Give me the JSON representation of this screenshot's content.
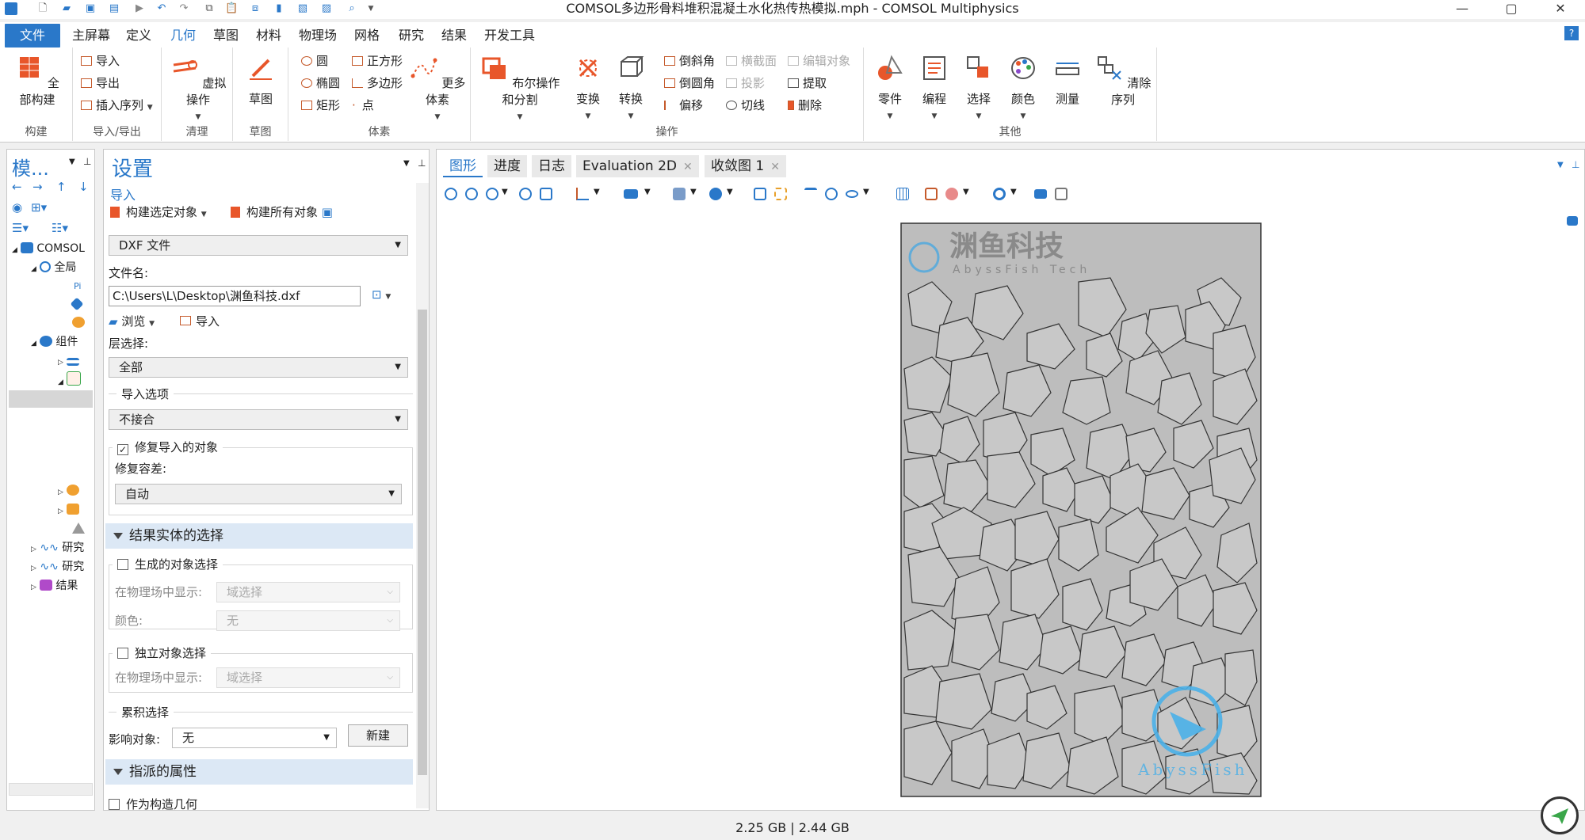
{
  "window": {
    "title": "COMSOL多边形骨料堆积混凝土水化热传热模拟.mph - COMSOL Multiphysics",
    "quick_access_icons": [
      "app-logo-icon",
      "new-file-icon",
      "open-icon",
      "save-icon",
      "save-as-icon",
      "run-icon",
      "undo-icon",
      "redo-icon",
      "copy-icon",
      "paste-icon",
      "duplicate-icon",
      "delete-icon",
      "select-icon",
      "clear-icon",
      "find-icon"
    ],
    "controls": {
      "minimize": "—",
      "maximize": "▢",
      "close": "✕"
    }
  },
  "ribbon_tabs": [
    "文件",
    "主屏幕",
    "定义",
    "几何",
    "草图",
    "材料",
    "物理场",
    "网格",
    "研究",
    "结果",
    "开发工具"
  ],
  "active_tab": "几何",
  "help_icon": "?",
  "ribbon": {
    "build": {
      "label": "构建",
      "build_all": "全部构建"
    },
    "import_export": {
      "label": "导入/导出",
      "import": "导入",
      "export": "导出",
      "insert_sequence": "插入序列"
    },
    "cleanup": {
      "label": "清理",
      "virtual_ops": "虚拟操作"
    },
    "sketch": {
      "label": "草图",
      "sketch": "草图"
    },
    "primitives": {
      "label": "体素",
      "circle": "圆",
      "ellipse": "椭圆",
      "rectangle": "矩形",
      "square": "正方形",
      "polygon": "多边形",
      "point": "点",
      "more": "更多体素"
    },
    "operations": {
      "label": "操作",
      "boolean": "布尔操作和分割",
      "transforms": "变换",
      "conversions": "转换",
      "chamfer": "倒斜角",
      "fillet": "倒圆角",
      "offset": "偏移",
      "cross_section": "横截面",
      "projection": "投影",
      "tangent": "切线",
      "edit_object": "编辑对象",
      "extract": "提取",
      "delete": "删除"
    },
    "other": {
      "label": "其他",
      "parts": "零件",
      "programming": "编程",
      "selections": "选择",
      "colors": "颜色",
      "measure": "测量",
      "clear_sequence": "清除序列"
    }
  },
  "model_builder": {
    "title": "模...",
    "tree": [
      {
        "label": "COMSOL",
        "icon": "model-icon"
      },
      {
        "label": "全局",
        "icon": "globe-icon"
      },
      {
        "label": "Pi",
        "icon": "parameters-icon"
      },
      {
        "label": "",
        "icon": "materials-icon"
      },
      {
        "label": "",
        "icon": "functions-icon"
      },
      {
        "label": "组件",
        "icon": "component-icon"
      },
      {
        "label": "",
        "icon": "definitions-icon"
      },
      {
        "label": "",
        "icon": "geometry-icon"
      },
      {
        "label": "",
        "icon": "physics-icon"
      },
      {
        "label": "",
        "icon": "material-icon"
      },
      {
        "label": "",
        "icon": "mesh-icon"
      },
      {
        "label": "研究",
        "icon": "study-icon"
      },
      {
        "label": "研究",
        "icon": "study-icon"
      },
      {
        "label": "结果",
        "icon": "results-icon"
      }
    ]
  },
  "settings": {
    "title": "设置",
    "subtitle": "导入",
    "build_selected": "构建选定对象",
    "build_all": "构建所有对象",
    "source": "DXF 文件",
    "filename_label": "文件名:",
    "filename": "C:\\Users\\L\\Desktop\\渊鱼科技.dxf",
    "browse": "浏览",
    "import": "导入",
    "layer_label": "层选择:",
    "layer_value": "全部",
    "import_options_label": "导入选项",
    "import_options_value": "不接合",
    "repair_label": "修复导入的对象",
    "repair_checked": true,
    "repair_tol_label": "修复容差:",
    "repair_tol_value": "自动",
    "section_result": "结果实体的选择",
    "gen_sel_label": "生成的对象选择",
    "show_in_physics_label": "在物理场中显示:",
    "show_in_physics_value": "域选择",
    "color_label": "颜色:",
    "color_value": "无",
    "indep_sel_label": "独立对象选择",
    "show_in_physics_label2": "在物理场中显示:",
    "show_in_physics_value2": "域选择",
    "cumulative_label": "累积选择",
    "contribute_label": "影响对象:",
    "contribute_value": "无",
    "new_button": "新建",
    "section_assigned": "指派的属性",
    "construction_geom": "作为构造几何"
  },
  "graphics": {
    "tabs": [
      {
        "label": "图形",
        "closable": false
      },
      {
        "label": "进度",
        "closable": false
      },
      {
        "label": "日志",
        "closable": false
      },
      {
        "label": "Evaluation 2D",
        "closable": true
      },
      {
        "label": "收敛图 1",
        "closable": true
      }
    ],
    "toolbar_icons": [
      "zoom-in-icon",
      "zoom-out-icon",
      "zoom-box-icon",
      "center-icon",
      "zoom-extents-icon",
      "axes-icon",
      "render-icon",
      "transparency-icon",
      "select-box-icon",
      "select-all-icon",
      "link-icon",
      "select-domains-icon",
      "hide-icon",
      "grid-icon",
      "scene-light-icon",
      "clear-icon",
      "camera-icon",
      "print-icon"
    ],
    "watermark_cn": "渊鱼科技",
    "watermark_en": "AbyssFish Tech",
    "watermark2": "AbyssFish"
  },
  "status": {
    "memory": "2.25 GB | 2.44 GB"
  },
  "colors": {
    "accent": "#2a78c9",
    "ribbon_icon": "#c55a2b",
    "aggregate_fill": "#c8c8c8",
    "domain_fill": "#bdbdbd"
  }
}
